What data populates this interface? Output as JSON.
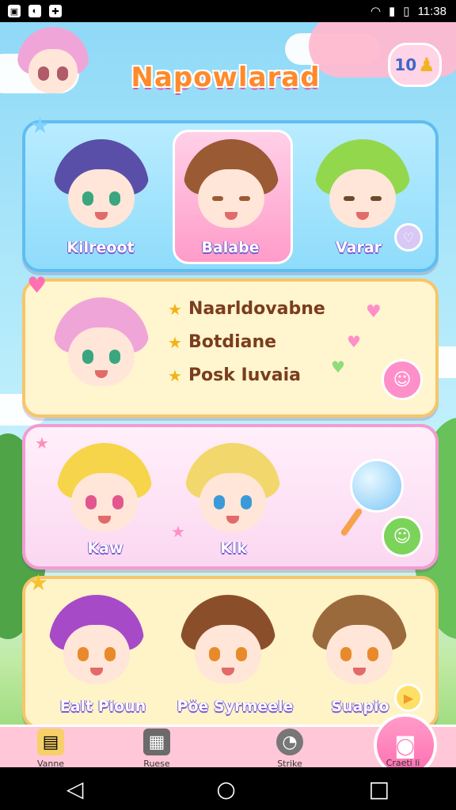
{
  "status_bar": {
    "time": "11:38"
  },
  "header": {
    "title": "Napowlarad",
    "badge_count": "10"
  },
  "card1": {
    "characters": [
      {
        "name": "Kilreoot",
        "hair": "#5a4fa8"
      },
      {
        "name": "Balabe",
        "hair": "#9a5a33"
      },
      {
        "name": "Varar",
        "hair": "#93d84c"
      }
    ]
  },
  "card2": {
    "character_hair": "#f0a5d8",
    "items": [
      "Naarldovabne",
      "Botdiane",
      "Posk Iuvaia"
    ]
  },
  "card3": {
    "characters": [
      {
        "name": "Kaw",
        "hair": "#f6d54a"
      },
      {
        "name": "Klk",
        "hair": "#f2d86c"
      }
    ]
  },
  "card4": {
    "characters": [
      {
        "name": "Ealt Pioun",
        "hair": "#a64ac8"
      },
      {
        "name": "Pöe Syrmeele",
        "hair": "#8b4e2b"
      },
      {
        "name": "Suapio",
        "hair": "#9b6a3c"
      }
    ]
  },
  "bottom_nav": {
    "items": [
      {
        "label": "Vanne",
        "icon": "notebook-icon"
      },
      {
        "label": "Ruese",
        "icon": "clapper-icon"
      },
      {
        "label": "Strike",
        "icon": "gauge-icon"
      }
    ],
    "fab_label": "Craeti li",
    "fab_icon": "camera-icon"
  },
  "colors": {
    "title": "#ff8a2b",
    "card_blue": "#8fdcfb",
    "card_yellow": "#fff5cf",
    "card_pink": "#fbd7f1",
    "nav_bg": "#ffc7d8"
  }
}
